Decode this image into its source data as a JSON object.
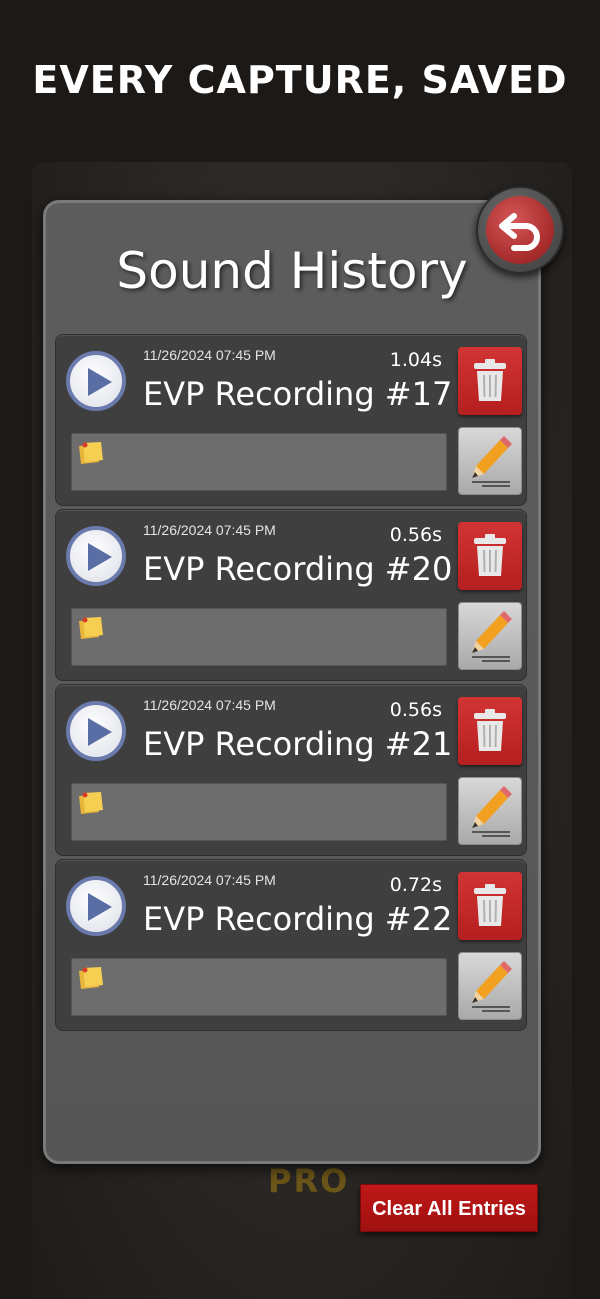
{
  "headline": "EVERY CAPTURE, SAVED",
  "background": {
    "brand_text": "PRO"
  },
  "panel": {
    "title": "Sound History"
  },
  "entries": [
    {
      "date": "11/26/2024 07:45 PM",
      "duration": "1.04s",
      "name": "EVP Recording #17",
      "note": ""
    },
    {
      "date": "11/26/2024 07:45 PM",
      "duration": "0.56s",
      "name": "EVP Recording #20",
      "note": ""
    },
    {
      "date": "11/26/2024 07:45 PM",
      "duration": "0.56s",
      "name": "EVP Recording #21",
      "note": ""
    },
    {
      "date": "11/26/2024 07:45 PM",
      "duration": "0.72s",
      "name": "EVP Recording #22",
      "note": ""
    }
  ],
  "actions": {
    "clear_all_label": "Clear All Entries"
  },
  "icons": {
    "back": "back-arrow-icon",
    "play": "play-icon",
    "note": "sticky-note-icon",
    "delete": "trash-icon",
    "edit": "pencil-icon"
  },
  "colors": {
    "accent_red": "#c01818",
    "play_ring": "#6a7aad",
    "panel": "#5a5a5a",
    "entry": "#3f3f3f"
  }
}
